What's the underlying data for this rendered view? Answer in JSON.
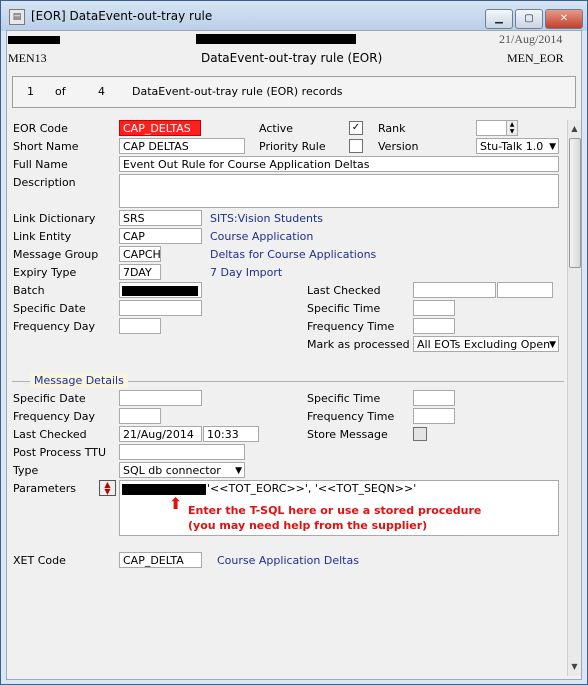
{
  "window": {
    "title": "[EOR] DataEvent-out-tray rule",
    "buttons": {
      "minimize": "▁",
      "maximize": "▢",
      "close": "✕"
    }
  },
  "header": {
    "code": "MEN13",
    "title": "DataEvent-out-tray rule (EOR)",
    "date": "21/Aug/2014",
    "form_id": "MEN_EOR"
  },
  "records": {
    "current": "1",
    "of_label": "of",
    "total": "4",
    "description": "DataEvent-out-tray rule (EOR) records"
  },
  "form": {
    "eor_code": {
      "label": "EOR Code",
      "value": "CAP_DELTAS"
    },
    "active": {
      "label": "Active",
      "checked": true,
      "mark": "✓"
    },
    "rank": {
      "label": "Rank",
      "value": ""
    },
    "short_name": {
      "label": "Short Name",
      "value": "CAP DELTAS"
    },
    "priority_rule": {
      "label": "Priority Rule",
      "checked": false
    },
    "version": {
      "label": "Version",
      "value": "Stu-Talk 1.0"
    },
    "full_name": {
      "label": "Full Name",
      "value": "Event Out Rule for Course Application Deltas"
    },
    "description": {
      "label": "Description",
      "value": ""
    },
    "link_dictionary": {
      "label": "Link Dictionary",
      "value": "SRS",
      "lookup": "SITS:Vision Students"
    },
    "link_entity": {
      "label": "Link Entity",
      "value": "CAP",
      "lookup": "Course Application"
    },
    "message_group": {
      "label": "Message Group",
      "value": "CAPCH",
      "lookup": "Deltas for Course Applications"
    },
    "expiry_type": {
      "label": "Expiry Type",
      "value": "7DAY",
      "lookup": "7 Day Import"
    },
    "batch": {
      "label": "Batch"
    },
    "last_checked": {
      "label": "Last Checked"
    },
    "specific_date": {
      "label": "Specific Date"
    },
    "specific_time": {
      "label": "Specific Time"
    },
    "frequency_day": {
      "label": "Frequency Day"
    },
    "frequency_time": {
      "label": "Frequency Time"
    },
    "mark_as_processed": {
      "label": "Mark as processed",
      "value": "All EOTs Excluding Open"
    }
  },
  "message_details": {
    "section_title": "Message Details",
    "specific_date": {
      "label": "Specific Date"
    },
    "specific_time": {
      "label": "Specific Time"
    },
    "frequency_day": {
      "label": "Frequency Day"
    },
    "frequency_time": {
      "label": "Frequency Time"
    },
    "last_checked": {
      "label": "Last Checked",
      "date": "21/Aug/2014",
      "time": "10:33"
    },
    "store_message": {
      "label": "Store Message",
      "checked": false
    },
    "post_process_ttu": {
      "label": "Post Process TTU"
    },
    "type": {
      "label": "Type",
      "value": "SQL db connector"
    },
    "parameters": {
      "label": "Parameters",
      "value_tail": "'<<TOT_EORC>>', '<<TOT_SEQN>>'"
    },
    "annotation": {
      "line1": "Enter the T-SQL here or use a stored procedure",
      "line2": "(you may need help from the supplier)"
    },
    "xet_code": {
      "label": "XET Code",
      "value": "CAP_DELTA",
      "lookup": "Course Application Deltas"
    }
  },
  "colors": {
    "eor_code_bg": "#ff1f1f",
    "link_text": "#1f2f8f",
    "annotation": "#e01010"
  }
}
